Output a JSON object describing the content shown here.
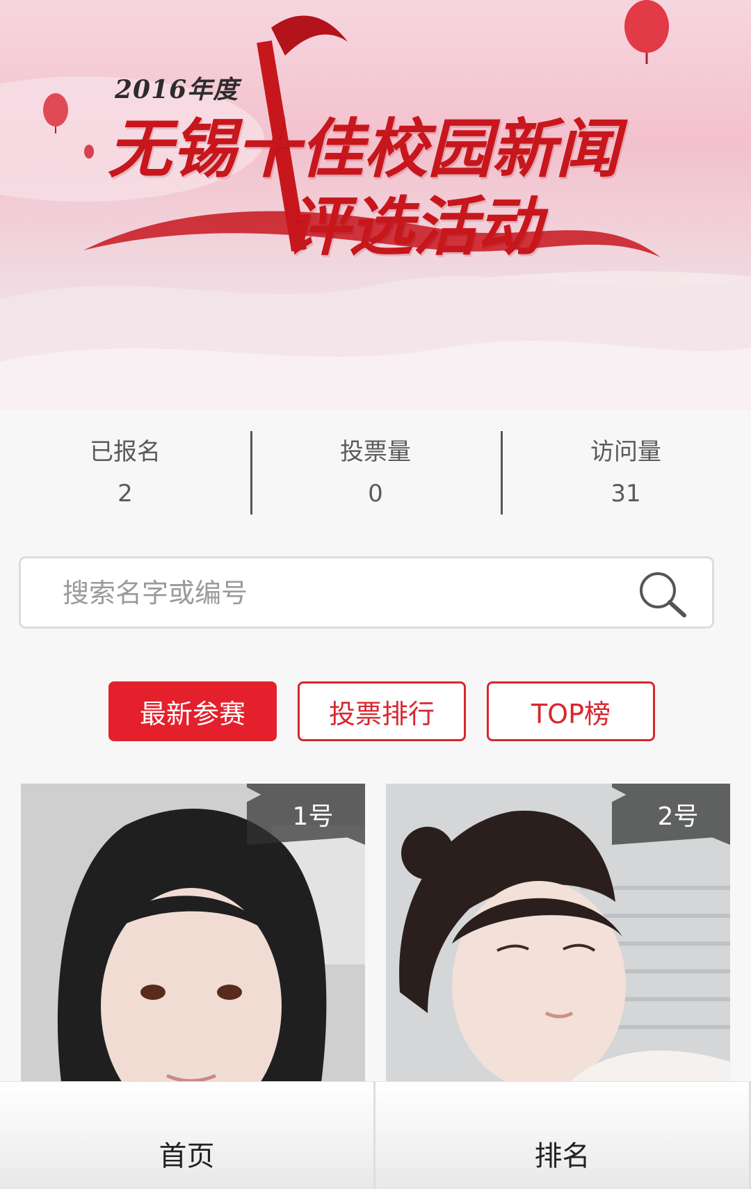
{
  "banner": {
    "year": "2016年度",
    "title_line1": "无锡十佳校园新闻",
    "title_line2": "评选活动"
  },
  "stats": [
    {
      "label": "已报名",
      "value": "2"
    },
    {
      "label": "投票量",
      "value": "0"
    },
    {
      "label": "访问量",
      "value": "31"
    }
  ],
  "search": {
    "placeholder": "搜索名字或编号"
  },
  "tabs": [
    {
      "label": "最新参赛",
      "active": true
    },
    {
      "label": "投票排行",
      "active": false
    },
    {
      "label": "TOP榜",
      "active": false
    }
  ],
  "contestants": [
    {
      "number": "1号"
    },
    {
      "number": "2号"
    }
  ],
  "bottom_nav": [
    {
      "label": "首页"
    },
    {
      "label": "排名"
    }
  ],
  "colors": {
    "accent": "#e4202d",
    "text": "#5a5a5a"
  }
}
